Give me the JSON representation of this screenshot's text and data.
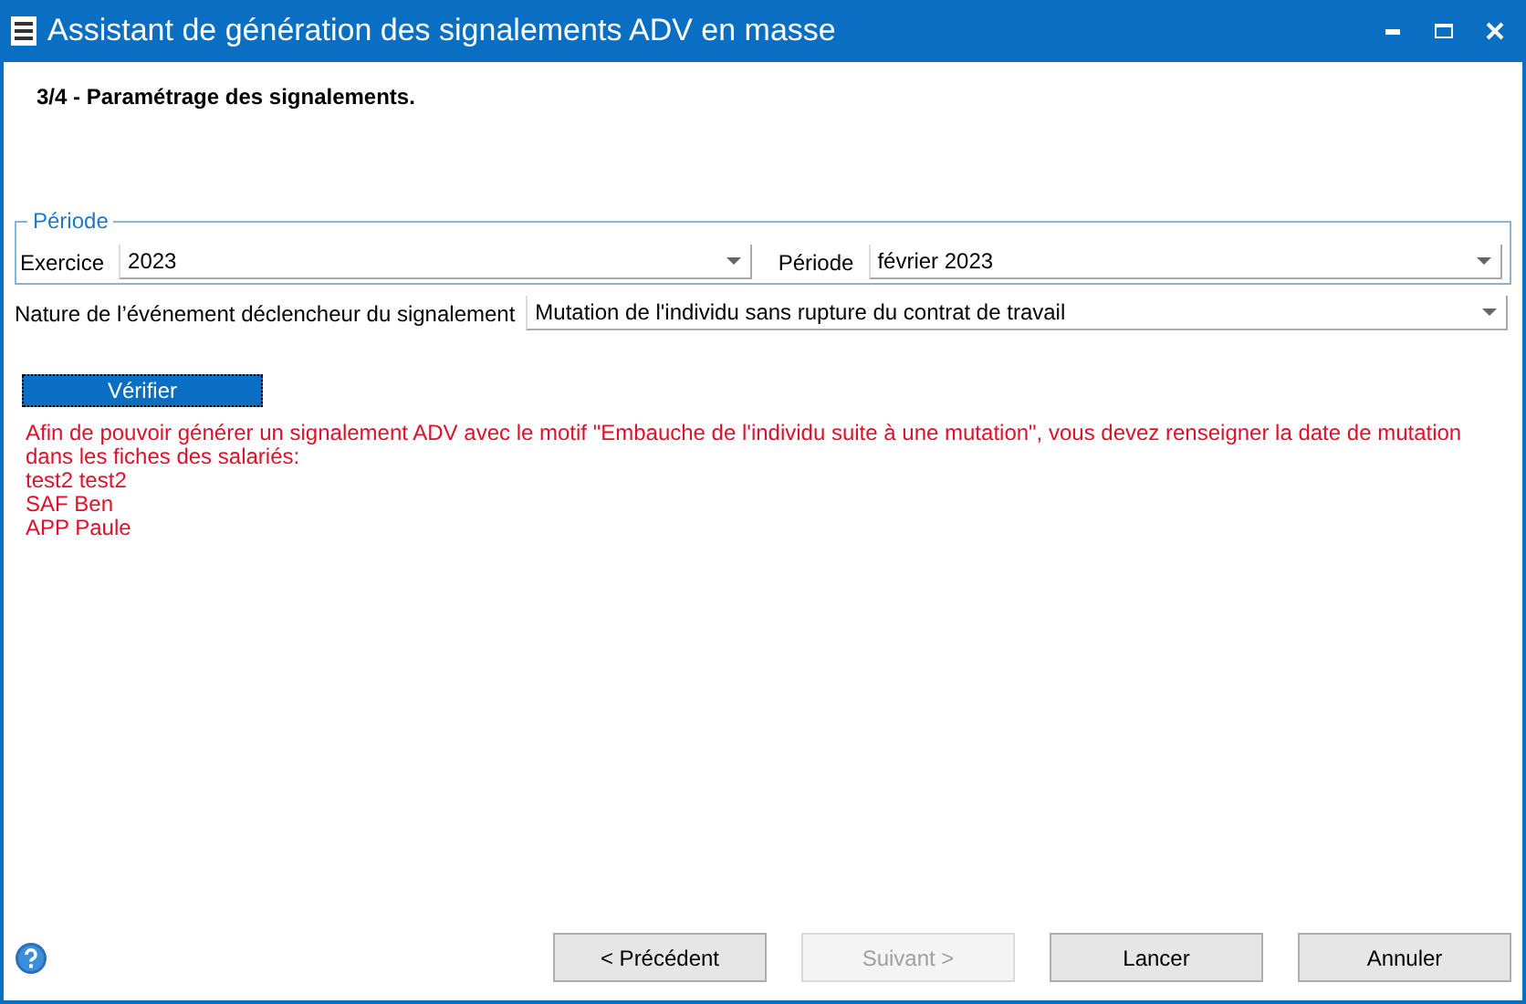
{
  "window": {
    "title": "Assistant de génération des signalements ADV en masse"
  },
  "step_title": "3/4 - Paramétrage des signalements.",
  "period_group": {
    "legend": "Période",
    "exercice": {
      "label": "Exercice",
      "value": "2023"
    },
    "periode": {
      "label": "Période",
      "value": "février 2023"
    }
  },
  "event_nature": {
    "label": "Nature de l’événement déclencheur du signalement",
    "value": "Mutation de l'individu sans rupture du contrat de travail"
  },
  "verify_button": {
    "label": "Vérifier",
    "focused": true
  },
  "message": "Afin de pouvoir générer un signalement ADV avec le motif \"Embauche de l'individu suite à une mutation\", vous devez renseigner la date de mutation dans les fiches des salariés:",
  "employees": [
    "test2 test2",
    "SAF Ben",
    "APP Paule"
  ],
  "buttons": [
    {
      "label": "< Précédent",
      "disabled": false
    },
    {
      "label": "Suivant >",
      "disabled": true
    },
    {
      "label": "Lancer",
      "disabled": false
    },
    {
      "label": "Annuler",
      "disabled": false
    }
  ]
}
